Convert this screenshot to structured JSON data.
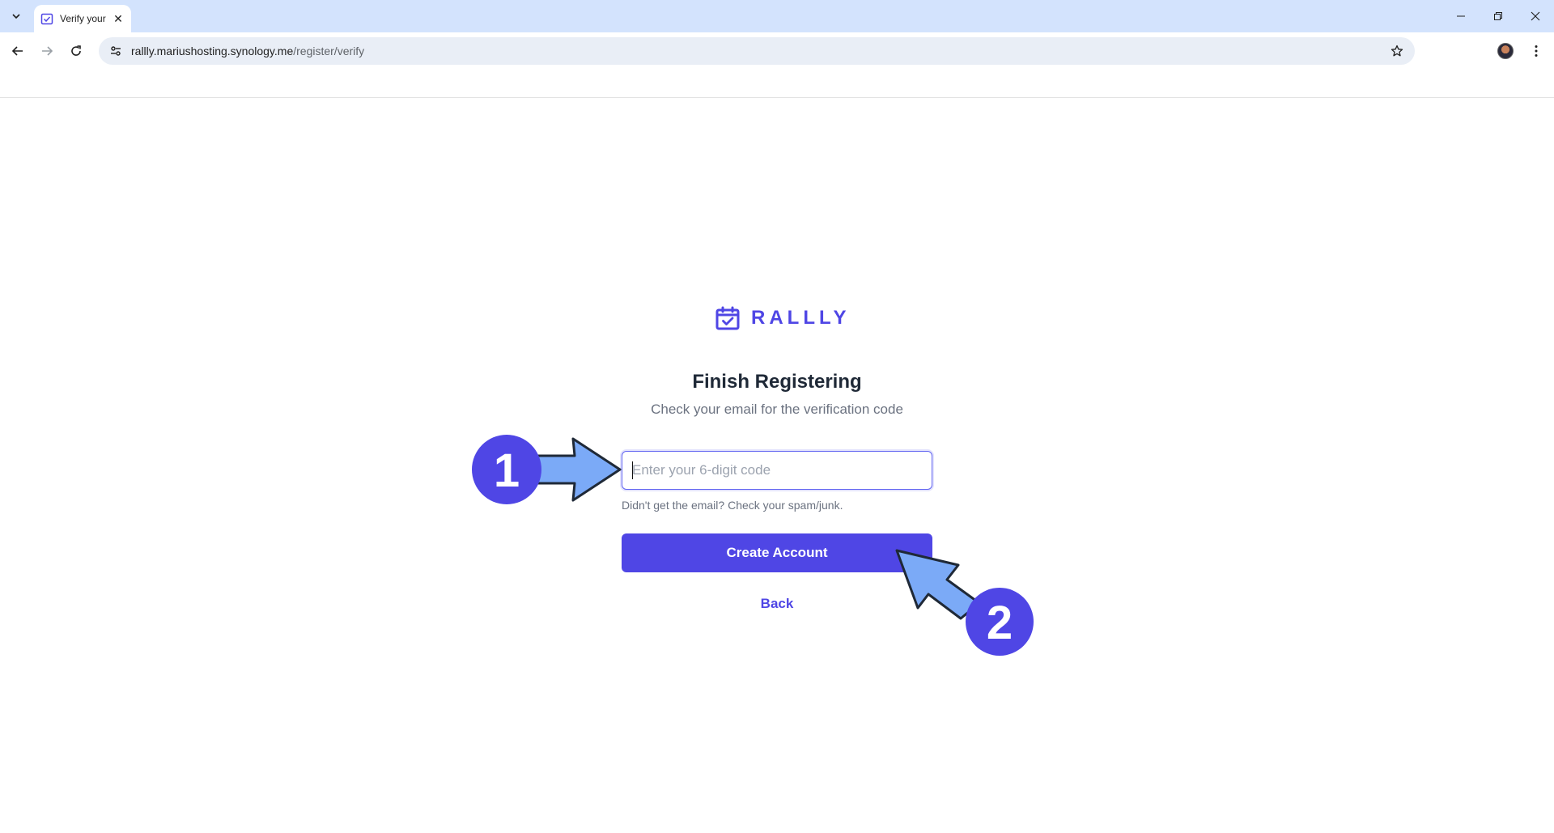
{
  "browser": {
    "tab_title": "Verify your",
    "url_host": "rallly.mariushosting.synology.me",
    "url_path": "/register/verify",
    "icons": [
      "tab-search-icon",
      "calendar-check-icon",
      "close-icon",
      "minimize-icon",
      "restore-icon",
      "back-icon",
      "forward-icon",
      "reload-icon",
      "site-settings-icon",
      "star-icon",
      "profile-avatar",
      "more-menu-icon"
    ]
  },
  "page": {
    "brand": "RALLLY",
    "heading": "Finish Registering",
    "subheading": "Check your email for the verification code",
    "code_placeholder": "Enter your 6-digit code",
    "code_value": "",
    "hint": "Didn't get the email? Check your spam/junk.",
    "create_button": "Create Account",
    "back_link": "Back"
  },
  "annotations": {
    "step1": "1",
    "step2": "2"
  },
  "colors": {
    "accent": "#4f46e5",
    "annotation_badge": "#4f46e5",
    "annotation_arrow": "#7baaf7",
    "tabstrip": "#d3e3fd"
  }
}
